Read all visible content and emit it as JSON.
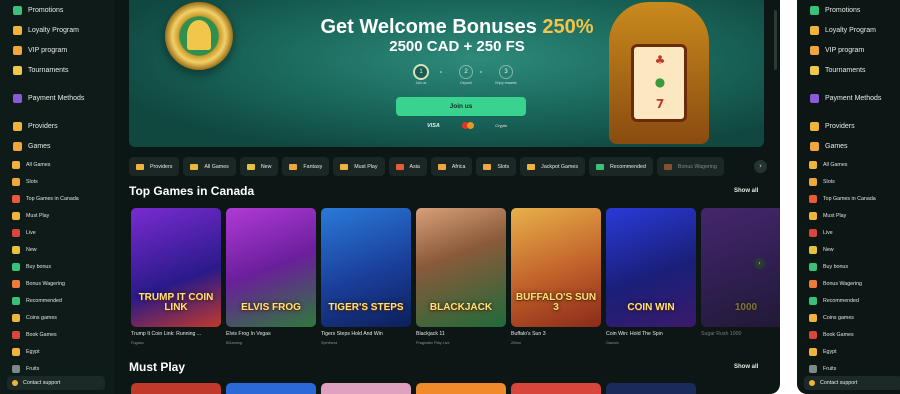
{
  "sidebar": {
    "top_items": [
      {
        "label": "Promotions",
        "icon": "gift-icon",
        "color": "#3ac07a"
      },
      {
        "label": "Loyalty Program",
        "icon": "crown-icon",
        "color": "#f0b43a"
      },
      {
        "label": "VIP program",
        "icon": "diamond-icon",
        "color": "#f0a63a"
      },
      {
        "label": "Tournaments",
        "icon": "trophy-icon",
        "color": "#f0c64b"
      }
    ],
    "mid_items": [
      {
        "label": "Payment Methods",
        "icon": "card-icon",
        "color": "#8a5bd8"
      }
    ],
    "providers_label": "Providers",
    "providers_icon_color": "#f0b43a",
    "games_label": "Games",
    "games_icon_color": "#f0a63a",
    "game_items": [
      {
        "label": "All Games",
        "icon": "grid-icon",
        "color": "#f0b43a"
      },
      {
        "label": "Slots",
        "icon": "slot-icon",
        "color": "#f0a63a"
      },
      {
        "label": "Top Games in Canada",
        "icon": "flame-icon",
        "color": "#e85a3a"
      },
      {
        "label": "Must Play",
        "icon": "star-icon",
        "color": "#f0b43a"
      },
      {
        "label": "Live",
        "icon": "live-icon",
        "color": "#d8453a"
      },
      {
        "label": "New",
        "icon": "new-badge-icon",
        "color": "#e6c33a"
      },
      {
        "label": "Buy bonus",
        "icon": "bag-icon",
        "color": "#3ac07a"
      },
      {
        "label": "Bonus Wagering",
        "icon": "bonus-icon",
        "color": "#f07a3a"
      },
      {
        "label": "Recommended",
        "icon": "check-icon",
        "color": "#3ac07a"
      },
      {
        "label": "Coins games",
        "icon": "coins-icon",
        "color": "#f0b43a"
      },
      {
        "label": "Book Games",
        "icon": "book-icon",
        "color": "#d8453a"
      },
      {
        "label": "Egypt",
        "icon": "pharaoh-icon",
        "color": "#f0b43a"
      },
      {
        "label": "Fruits",
        "icon": "fruit-icon",
        "color": "#7a8a84"
      }
    ],
    "support_label": "Contact support"
  },
  "banner": {
    "title_prefix": "Get Welcome Bonuses ",
    "title_pct": "250%",
    "subtitle": "2500 CAD + 250 FS",
    "steps": [
      {
        "num": "1",
        "label": "Join us"
      },
      {
        "num": "2",
        "label": "Deposit"
      },
      {
        "num": "3",
        "label": "Enjoy rewards"
      }
    ],
    "join_label": "Join us",
    "payments": [
      "VISA",
      "Crypto"
    ]
  },
  "filters": [
    {
      "label": "Providers",
      "color": "#f0b43a",
      "dim": false
    },
    {
      "label": "All Games",
      "color": "#f0b43a",
      "dim": false
    },
    {
      "label": "New",
      "color": "#e6c33a",
      "dim": false
    },
    {
      "label": "Fantasy",
      "color": "#f0a63a",
      "dim": false
    },
    {
      "label": "Must Play",
      "color": "#f0b43a",
      "dim": false
    },
    {
      "label": "Asia",
      "color": "#e85a3a",
      "dim": false
    },
    {
      "label": "Africa",
      "color": "#f0a63a",
      "dim": false
    },
    {
      "label": "Slots",
      "color": "#f0a63a",
      "dim": false
    },
    {
      "label": "Jackpot Games",
      "color": "#f0b43a",
      "dim": false
    },
    {
      "label": "Recommended",
      "color": "#3ac07a",
      "dim": false
    },
    {
      "label": "Bonus Wagering",
      "color": "#f07a3a",
      "dim": true
    }
  ],
  "sections": {
    "top_games_title": "Top Games in Canada",
    "must_play_title": "Must Play",
    "show_all": "Show all"
  },
  "games": [
    {
      "name": "Trump It Coin Link: Running ...",
      "provider": "Fugaso",
      "logo": "TRUMP IT COIN LINK",
      "bg": "linear-gradient(160deg,#7a2bd0,#2a1a8a 60%,#c0392b)"
    },
    {
      "name": "Elvis Frog In Vegas",
      "provider": "BGaming",
      "logo": "ELVIS FROG",
      "bg": "linear-gradient(160deg,#b03ad8,#6a1f9a 50%,#2e7a3a)"
    },
    {
      "name": "Tigers Steps Hold And Win",
      "provider": "Spinthera",
      "logo": "TIGER'S STEPS",
      "bg": "linear-gradient(160deg,#2a7ad8,#1a3f9a 55%,#0d1f5a)"
    },
    {
      "name": "Blackjack 11",
      "provider": "Pragmatic Play Live",
      "logo": "BLACKJACK",
      "bg": "linear-gradient(160deg,#d8a07a,#8a5a3a 40%,#1f6a3a)"
    },
    {
      "name": "Buffalo's Sun 3",
      "provider": "Zillion",
      "logo": "BUFFALO'S SUN 3",
      "bg": "linear-gradient(160deg,#e8b04a,#c0602a 55%,#8a2a1a)"
    },
    {
      "name": "Coin Win: Hold The Spin",
      "provider": "Gamzix",
      "logo": "COIN WIN",
      "bg": "linear-gradient(160deg,#2a3ad8,#1a1f7a 55%,#3a1a6a)"
    },
    {
      "name": "Sugar Rush 1000",
      "provider": "",
      "logo": "1000",
      "bg": "linear-gradient(160deg,#8a3ad8,#5a2a9a 55%,#3a1f5a)"
    }
  ],
  "must_play_colors": [
    "#c0392b",
    "#2a6ad8",
    "#e0a0c0",
    "#f08a2a",
    "#d8453a",
    "#1a2a5a"
  ]
}
